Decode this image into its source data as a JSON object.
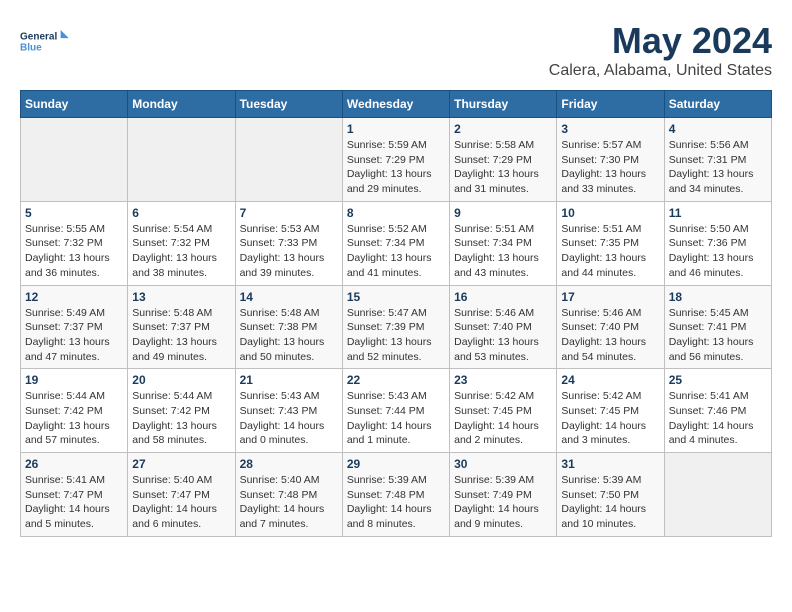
{
  "logo": {
    "text_general": "General",
    "text_blue": "Blue"
  },
  "title": "May 2024",
  "subtitle": "Calera, Alabama, United States",
  "weekdays": [
    "Sunday",
    "Monday",
    "Tuesday",
    "Wednesday",
    "Thursday",
    "Friday",
    "Saturday"
  ],
  "weeks": [
    [
      {
        "day": "",
        "info": ""
      },
      {
        "day": "",
        "info": ""
      },
      {
        "day": "",
        "info": ""
      },
      {
        "day": "1",
        "info": "Sunrise: 5:59 AM\nSunset: 7:29 PM\nDaylight: 13 hours\nand 29 minutes."
      },
      {
        "day": "2",
        "info": "Sunrise: 5:58 AM\nSunset: 7:29 PM\nDaylight: 13 hours\nand 31 minutes."
      },
      {
        "day": "3",
        "info": "Sunrise: 5:57 AM\nSunset: 7:30 PM\nDaylight: 13 hours\nand 33 minutes."
      },
      {
        "day": "4",
        "info": "Sunrise: 5:56 AM\nSunset: 7:31 PM\nDaylight: 13 hours\nand 34 minutes."
      }
    ],
    [
      {
        "day": "5",
        "info": "Sunrise: 5:55 AM\nSunset: 7:32 PM\nDaylight: 13 hours\nand 36 minutes."
      },
      {
        "day": "6",
        "info": "Sunrise: 5:54 AM\nSunset: 7:32 PM\nDaylight: 13 hours\nand 38 minutes."
      },
      {
        "day": "7",
        "info": "Sunrise: 5:53 AM\nSunset: 7:33 PM\nDaylight: 13 hours\nand 39 minutes."
      },
      {
        "day": "8",
        "info": "Sunrise: 5:52 AM\nSunset: 7:34 PM\nDaylight: 13 hours\nand 41 minutes."
      },
      {
        "day": "9",
        "info": "Sunrise: 5:51 AM\nSunset: 7:34 PM\nDaylight: 13 hours\nand 43 minutes."
      },
      {
        "day": "10",
        "info": "Sunrise: 5:51 AM\nSunset: 7:35 PM\nDaylight: 13 hours\nand 44 minutes."
      },
      {
        "day": "11",
        "info": "Sunrise: 5:50 AM\nSunset: 7:36 PM\nDaylight: 13 hours\nand 46 minutes."
      }
    ],
    [
      {
        "day": "12",
        "info": "Sunrise: 5:49 AM\nSunset: 7:37 PM\nDaylight: 13 hours\nand 47 minutes."
      },
      {
        "day": "13",
        "info": "Sunrise: 5:48 AM\nSunset: 7:37 PM\nDaylight: 13 hours\nand 49 minutes."
      },
      {
        "day": "14",
        "info": "Sunrise: 5:48 AM\nSunset: 7:38 PM\nDaylight: 13 hours\nand 50 minutes."
      },
      {
        "day": "15",
        "info": "Sunrise: 5:47 AM\nSunset: 7:39 PM\nDaylight: 13 hours\nand 52 minutes."
      },
      {
        "day": "16",
        "info": "Sunrise: 5:46 AM\nSunset: 7:40 PM\nDaylight: 13 hours\nand 53 minutes."
      },
      {
        "day": "17",
        "info": "Sunrise: 5:46 AM\nSunset: 7:40 PM\nDaylight: 13 hours\nand 54 minutes."
      },
      {
        "day": "18",
        "info": "Sunrise: 5:45 AM\nSunset: 7:41 PM\nDaylight: 13 hours\nand 56 minutes."
      }
    ],
    [
      {
        "day": "19",
        "info": "Sunrise: 5:44 AM\nSunset: 7:42 PM\nDaylight: 13 hours\nand 57 minutes."
      },
      {
        "day": "20",
        "info": "Sunrise: 5:44 AM\nSunset: 7:42 PM\nDaylight: 13 hours\nand 58 minutes."
      },
      {
        "day": "21",
        "info": "Sunrise: 5:43 AM\nSunset: 7:43 PM\nDaylight: 14 hours\nand 0 minutes."
      },
      {
        "day": "22",
        "info": "Sunrise: 5:43 AM\nSunset: 7:44 PM\nDaylight: 14 hours\nand 1 minute."
      },
      {
        "day": "23",
        "info": "Sunrise: 5:42 AM\nSunset: 7:45 PM\nDaylight: 14 hours\nand 2 minutes."
      },
      {
        "day": "24",
        "info": "Sunrise: 5:42 AM\nSunset: 7:45 PM\nDaylight: 14 hours\nand 3 minutes."
      },
      {
        "day": "25",
        "info": "Sunrise: 5:41 AM\nSunset: 7:46 PM\nDaylight: 14 hours\nand 4 minutes."
      }
    ],
    [
      {
        "day": "26",
        "info": "Sunrise: 5:41 AM\nSunset: 7:47 PM\nDaylight: 14 hours\nand 5 minutes."
      },
      {
        "day": "27",
        "info": "Sunrise: 5:40 AM\nSunset: 7:47 PM\nDaylight: 14 hours\nand 6 minutes."
      },
      {
        "day": "28",
        "info": "Sunrise: 5:40 AM\nSunset: 7:48 PM\nDaylight: 14 hours\nand 7 minutes."
      },
      {
        "day": "29",
        "info": "Sunrise: 5:39 AM\nSunset: 7:48 PM\nDaylight: 14 hours\nand 8 minutes."
      },
      {
        "day": "30",
        "info": "Sunrise: 5:39 AM\nSunset: 7:49 PM\nDaylight: 14 hours\nand 9 minutes."
      },
      {
        "day": "31",
        "info": "Sunrise: 5:39 AM\nSunset: 7:50 PM\nDaylight: 14 hours\nand 10 minutes."
      },
      {
        "day": "",
        "info": ""
      }
    ]
  ]
}
